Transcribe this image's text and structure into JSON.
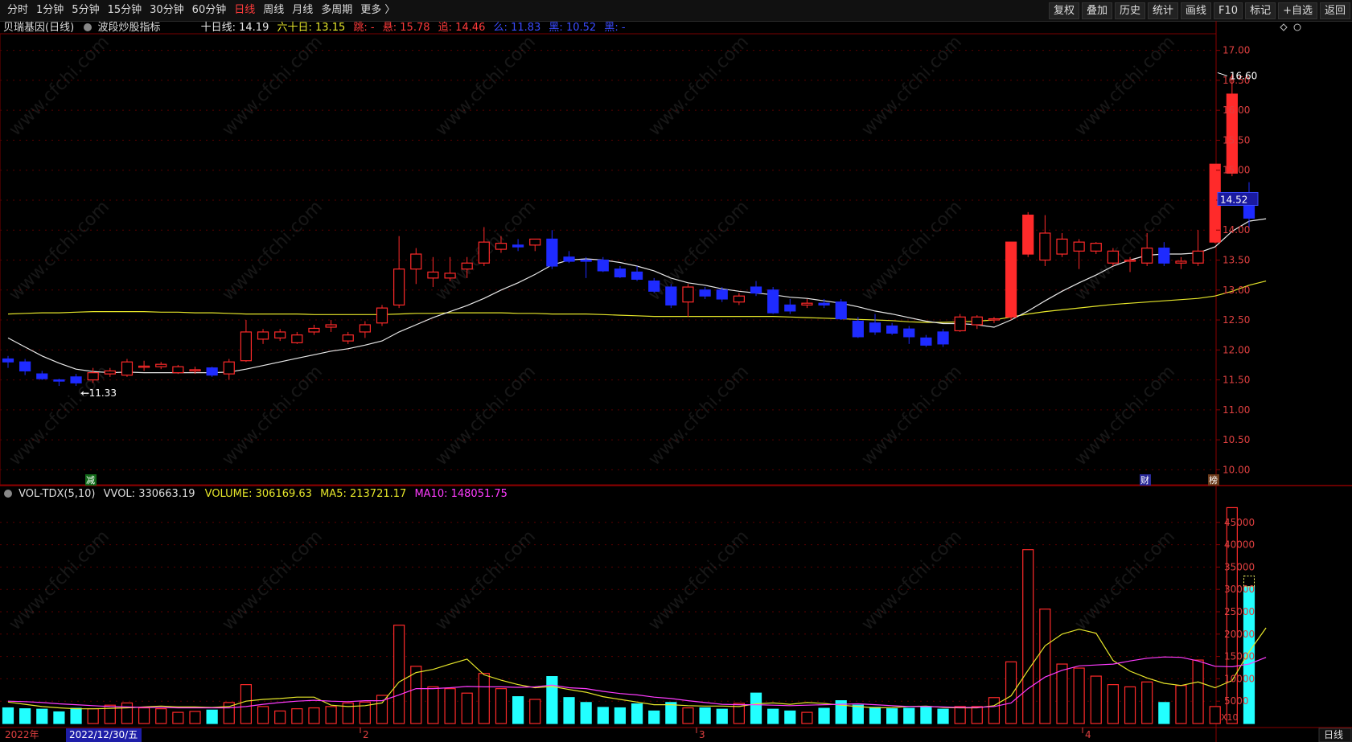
{
  "toolbar": {
    "periods": [
      "分时",
      "1分钟",
      "5分钟",
      "15分钟",
      "30分钟",
      "60分钟",
      "日线",
      "周线",
      "月线",
      "多周期",
      "更多 〉"
    ],
    "active_period": "日线",
    "tools": [
      "复权",
      "叠加",
      "历史",
      "统计",
      "画线",
      "F10",
      "标记",
      "+自选",
      "返回"
    ]
  },
  "header": {
    "stock_name": "贝瑞基因(日线)",
    "indicator": "波段炒股指标",
    "ma10_label": "十日线:",
    "ma10_value": "14.19",
    "ma60_label": "六十日:",
    "ma60_value": "13.15",
    "label3": "跳:",
    "value3": "-",
    "label4": "悬:",
    "value4": "15.78",
    "label5": "追:",
    "value5": "14.46",
    "label6": "么:",
    "value6": "11.83",
    "label7": "黑:",
    "value7": "10.52",
    "label8": "黑:",
    "value8": "-"
  },
  "price_axis": [
    "17.00",
    "16.50",
    "16.00",
    "15.50",
    "15.00",
    "14.50",
    "14.00",
    "13.50",
    "13.00",
    "12.50",
    "12.00",
    "11.50",
    "11.00",
    "10.50",
    "10.00"
  ],
  "current_price": "14.52",
  "high_marker": "16.60",
  "low_marker": "11.33",
  "event_markers": {
    "left": "减",
    "cai": "财",
    "bang": "榜"
  },
  "volume_panel": {
    "title": "VOL-TDX(5,10)",
    "vvol_label": "VVOL:",
    "vvol_value": "330663.19",
    "volume_label": "VOLUME:",
    "volume_value": "306169.63",
    "ma5_label": "MA5:",
    "ma5_value": "213721.17",
    "ma10_label": "MA10:",
    "ma10_value": "148051.75",
    "axis": [
      "45000",
      "40000",
      "35000",
      "30000",
      "25000",
      "20000",
      "15000",
      "10000",
      "5000"
    ],
    "unit": "X10"
  },
  "time_axis": {
    "year": "2022年",
    "cursor_date": "2022/12/30/五",
    "months": [
      "2",
      "3",
      "4"
    ]
  },
  "period_button": "日线",
  "watermark": "www.cfchi.com",
  "colors": {
    "up": "#ff2a2a",
    "down": "#1e2bff",
    "vol_down": "#22ffff",
    "ma_white": "#e8e8e8",
    "ma_yellow": "#e6e62a",
    "ma_magenta": "#ff3cff",
    "grid": "#5a0000"
  },
  "chart_data": {
    "type": "candlestick",
    "candles": [
      {
        "o": 11.85,
        "h": 11.9,
        "l": 11.7,
        "c": 11.8
      },
      {
        "o": 11.8,
        "h": 11.85,
        "l": 11.58,
        "c": 11.65
      },
      {
        "o": 11.6,
        "h": 11.65,
        "l": 11.5,
        "c": 11.52
      },
      {
        "o": 11.5,
        "h": 11.52,
        "l": 11.4,
        "c": 11.48
      },
      {
        "o": 11.55,
        "h": 11.6,
        "l": 11.4,
        "c": 11.45
      },
      {
        "o": 11.5,
        "h": 11.7,
        "l": 11.45,
        "c": 11.62
      },
      {
        "o": 11.6,
        "h": 11.7,
        "l": 11.55,
        "c": 11.65
      },
      {
        "o": 11.58,
        "h": 11.85,
        "l": 11.55,
        "c": 11.8
      },
      {
        "o": 11.72,
        "h": 11.82,
        "l": 11.65,
        "c": 11.73
      },
      {
        "o": 11.72,
        "h": 11.8,
        "l": 11.68,
        "c": 11.76
      },
      {
        "o": 11.62,
        "h": 11.75,
        "l": 11.6,
        "c": 11.72
      },
      {
        "o": 11.65,
        "h": 11.72,
        "l": 11.6,
        "c": 11.67
      },
      {
        "o": 11.7,
        "h": 11.72,
        "l": 11.55,
        "c": 11.58
      },
      {
        "o": 11.6,
        "h": 11.85,
        "l": 11.5,
        "c": 11.8
      },
      {
        "o": 11.82,
        "h": 12.5,
        "l": 11.8,
        "c": 12.3
      },
      {
        "o": 12.18,
        "h": 12.35,
        "l": 12.1,
        "c": 12.3
      },
      {
        "o": 12.2,
        "h": 12.35,
        "l": 12.15,
        "c": 12.3
      },
      {
        "o": 12.12,
        "h": 12.3,
        "l": 12.1,
        "c": 12.25
      },
      {
        "o": 12.3,
        "h": 12.42,
        "l": 12.25,
        "c": 12.36
      },
      {
        "o": 12.38,
        "h": 12.5,
        "l": 12.3,
        "c": 12.42
      },
      {
        "o": 12.15,
        "h": 12.3,
        "l": 12.1,
        "c": 12.25
      },
      {
        "o": 12.3,
        "h": 12.48,
        "l": 12.2,
        "c": 12.42
      },
      {
        "o": 12.45,
        "h": 12.75,
        "l": 12.4,
        "c": 12.7
      },
      {
        "o": 12.75,
        "h": 13.9,
        "l": 12.7,
        "c": 13.35
      },
      {
        "o": 13.35,
        "h": 13.7,
        "l": 13.1,
        "c": 13.6
      },
      {
        "o": 13.2,
        "h": 13.55,
        "l": 13.05,
        "c": 13.3
      },
      {
        "o": 13.2,
        "h": 13.55,
        "l": 13.15,
        "c": 13.28
      },
      {
        "o": 13.35,
        "h": 13.55,
        "l": 13.2,
        "c": 13.45
      },
      {
        "o": 13.45,
        "h": 14.05,
        "l": 13.4,
        "c": 13.8
      },
      {
        "o": 13.68,
        "h": 13.9,
        "l": 13.62,
        "c": 13.78
      },
      {
        "o": 13.75,
        "h": 13.85,
        "l": 13.65,
        "c": 13.72
      },
      {
        "o": 13.75,
        "h": 13.85,
        "l": 13.65,
        "c": 13.85
      },
      {
        "o": 13.85,
        "h": 14.0,
        "l": 13.35,
        "c": 13.4
      },
      {
        "o": 13.55,
        "h": 13.65,
        "l": 13.45,
        "c": 13.48
      },
      {
        "o": 13.5,
        "h": 13.55,
        "l": 13.2,
        "c": 13.48
      },
      {
        "o": 13.5,
        "h": 13.55,
        "l": 13.3,
        "c": 13.32
      },
      {
        "o": 13.35,
        "h": 13.4,
        "l": 13.2,
        "c": 13.22
      },
      {
        "o": 13.3,
        "h": 13.4,
        "l": 13.15,
        "c": 13.18
      },
      {
        "o": 13.15,
        "h": 13.2,
        "l": 12.95,
        "c": 12.98
      },
      {
        "o": 13.05,
        "h": 13.1,
        "l": 12.7,
        "c": 12.75
      },
      {
        "o": 12.8,
        "h": 13.1,
        "l": 12.55,
        "c": 13.05
      },
      {
        "o": 13.0,
        "h": 13.05,
        "l": 12.85,
        "c": 12.9
      },
      {
        "o": 13.0,
        "h": 13.05,
        "l": 12.8,
        "c": 12.85
      },
      {
        "o": 12.8,
        "h": 12.95,
        "l": 12.75,
        "c": 12.9
      },
      {
        "o": 13.05,
        "h": 13.15,
        "l": 12.9,
        "c": 12.95
      },
      {
        "o": 13.0,
        "h": 13.05,
        "l": 12.6,
        "c": 12.62
      },
      {
        "o": 12.75,
        "h": 12.85,
        "l": 12.6,
        "c": 12.65
      },
      {
        "o": 12.75,
        "h": 12.85,
        "l": 12.7,
        "c": 12.78
      },
      {
        "o": 12.78,
        "h": 12.85,
        "l": 12.7,
        "c": 12.75
      },
      {
        "o": 12.8,
        "h": 12.85,
        "l": 12.5,
        "c": 12.52
      },
      {
        "o": 12.48,
        "h": 12.55,
        "l": 12.2,
        "c": 12.22
      },
      {
        "o": 12.45,
        "h": 12.6,
        "l": 12.25,
        "c": 12.3
      },
      {
        "o": 12.4,
        "h": 12.45,
        "l": 12.25,
        "c": 12.28
      },
      {
        "o": 12.35,
        "h": 12.4,
        "l": 12.1,
        "c": 12.22
      },
      {
        "o": 12.2,
        "h": 12.25,
        "l": 12.05,
        "c": 12.08
      },
      {
        "o": 12.3,
        "h": 12.35,
        "l": 12.05,
        "c": 12.1
      },
      {
        "o": 12.32,
        "h": 12.6,
        "l": 12.3,
        "c": 12.55
      },
      {
        "o": 12.42,
        "h": 12.58,
        "l": 12.35,
        "c": 12.55
      },
      {
        "o": 12.5,
        "h": 12.55,
        "l": 12.45,
        "c": 12.52
      },
      {
        "o": 12.55,
        "h": 13.8,
        "l": 12.5,
        "c": 13.8
      },
      {
        "o": 13.6,
        "h": 14.3,
        "l": 13.55,
        "c": 14.25
      },
      {
        "o": 13.5,
        "h": 14.25,
        "l": 13.4,
        "c": 13.95
      },
      {
        "o": 13.6,
        "h": 13.95,
        "l": 13.55,
        "c": 13.85
      },
      {
        "o": 13.65,
        "h": 13.85,
        "l": 13.35,
        "c": 13.8
      },
      {
        "o": 13.65,
        "h": 13.8,
        "l": 13.6,
        "c": 13.78
      },
      {
        "o": 13.45,
        "h": 13.7,
        "l": 13.4,
        "c": 13.65
      },
      {
        "o": 13.5,
        "h": 13.55,
        "l": 13.3,
        "c": 13.5
      },
      {
        "o": 13.45,
        "h": 13.95,
        "l": 13.4,
        "c": 13.7
      },
      {
        "o": 13.7,
        "h": 13.8,
        "l": 13.4,
        "c": 13.45
      },
      {
        "o": 13.45,
        "h": 13.55,
        "l": 13.35,
        "c": 13.48
      },
      {
        "o": 13.45,
        "h": 14.0,
        "l": 13.4,
        "c": 13.65
      },
      {
        "o": 13.8,
        "h": 15.1,
        "l": 13.78,
        "c": 15.1
      },
      {
        "o": 14.95,
        "h": 16.6,
        "l": 14.9,
        "c": 16.27
      },
      {
        "o": 14.52,
        "h": 14.8,
        "l": 14.0,
        "c": 14.2
      }
    ],
    "ma10": [
      12.2,
      12.05,
      11.9,
      11.78,
      11.68,
      11.64,
      11.62,
      11.63,
      11.62,
      11.62,
      11.62,
      11.62,
      11.62,
      11.63,
      11.68,
      11.74,
      11.8,
      11.86,
      11.92,
      11.98,
      12.02,
      12.08,
      12.15,
      12.3,
      12.42,
      12.54,
      12.64,
      12.74,
      12.86,
      13.0,
      13.12,
      13.26,
      13.42,
      13.5,
      13.52,
      13.5,
      13.46,
      13.4,
      13.32,
      13.2,
      13.12,
      13.08,
      13.02,
      12.98,
      12.95,
      12.92,
      12.88,
      12.86,
      12.82,
      12.78,
      12.72,
      12.65,
      12.6,
      12.54,
      12.48,
      12.44,
      12.44,
      12.42,
      12.38,
      12.5,
      12.65,
      12.82,
      12.98,
      13.12,
      13.25,
      13.4,
      13.5,
      13.58,
      13.6,
      13.6,
      13.62,
      13.72,
      13.98,
      14.15,
      14.19
    ],
    "ma60": [
      12.6,
      12.61,
      12.62,
      12.62,
      12.63,
      12.64,
      12.64,
      12.64,
      12.64,
      12.63,
      12.63,
      12.62,
      12.62,
      12.61,
      12.6,
      12.6,
      12.6,
      12.6,
      12.59,
      12.59,
      12.59,
      12.59,
      12.59,
      12.6,
      12.61,
      12.61,
      12.62,
      12.62,
      12.62,
      12.62,
      12.61,
      12.61,
      12.6,
      12.6,
      12.6,
      12.59,
      12.58,
      12.57,
      12.56,
      12.56,
      12.56,
      12.56,
      12.56,
      12.56,
      12.56,
      12.56,
      12.55,
      12.54,
      12.53,
      12.52,
      12.51,
      12.5,
      12.49,
      12.47,
      12.46,
      12.46,
      12.47,
      12.48,
      12.5,
      12.55,
      12.6,
      12.64,
      12.67,
      12.7,
      12.73,
      12.76,
      12.78,
      12.8,
      12.82,
      12.84,
      12.86,
      12.9,
      12.98,
      13.08,
      13.15
    ],
    "volume": [
      3500,
      3300,
      3200,
      2600,
      3400,
      3300,
      4100,
      4600,
      3500,
      3300,
      2500,
      2700,
      3000,
      4700,
      8700,
      3800,
      2800,
      3300,
      3500,
      3800,
      4600,
      4800,
      6300,
      22000,
      12800,
      8200,
      7800,
      6800,
      11200,
      7800,
      6000,
      5400,
      10500,
      5800,
      4700,
      3600,
      3500,
      4400,
      2800,
      4700,
      3500,
      3500,
      3200,
      4500,
      6800,
      3200,
      2800,
      2500,
      3400,
      5100,
      4100,
      3600,
      3300,
      3400,
      3600,
      3200,
      3800,
      3800,
      5800,
      13800,
      38900,
      25600,
      13300,
      12400,
      10600,
      8700,
      8200,
      9300,
      4700,
      8500,
      14200,
      3800,
      48300,
      30600
    ],
    "ma5_vol": [
      4800,
      4300,
      3800,
      3500,
      3300,
      3300,
      3400,
      3500,
      3700,
      3900,
      3700,
      3700,
      3600,
      3800,
      5000,
      5400,
      5600,
      5900,
      5900,
      4100,
      3800,
      4000,
      4600,
      9300,
      11400,
      12100,
      13300,
      14400,
      10900,
      9700,
      8700,
      8000,
      8300,
      7600,
      7000,
      6000,
      5400,
      4800,
      4200,
      4200,
      4000,
      3900,
      3900,
      3800,
      4400,
      4600,
      4300,
      4700,
      4500,
      4100,
      3800,
      3500,
      3600,
      3800,
      3900,
      3600,
      3500,
      3500,
      4000,
      6200,
      11900,
      17400,
      20000,
      21100,
      20200,
      14100,
      11700,
      10200,
      9000,
      8500,
      9300,
      8000,
      9600,
      16000,
      21400
    ],
    "ma10_vol": [
      5000,
      4900,
      4700,
      4400,
      4200,
      4000,
      3800,
      3700,
      3600,
      3600,
      3500,
      3500,
      3500,
      3500,
      3800,
      4300,
      4700,
      5000,
      5200,
      5000,
      4900,
      5100,
      5100,
      6400,
      7800,
      7800,
      8000,
      8300,
      8200,
      8200,
      8100,
      8200,
      8600,
      8000,
      7800,
      7200,
      6700,
      6400,
      5900,
      5600,
      5100,
      4700,
      4300,
      4200,
      4200,
      4100,
      4000,
      4100,
      4200,
      4300,
      4400,
      4200,
      4000,
      3800,
      3800,
      3700,
      3600,
      3600,
      3800,
      4600,
      7800,
      10400,
      11900,
      12900,
      13100,
      13300,
      14000,
      14600,
      14900,
      14800,
      14000,
      12800,
      12700,
      13300,
      14800
    ]
  }
}
